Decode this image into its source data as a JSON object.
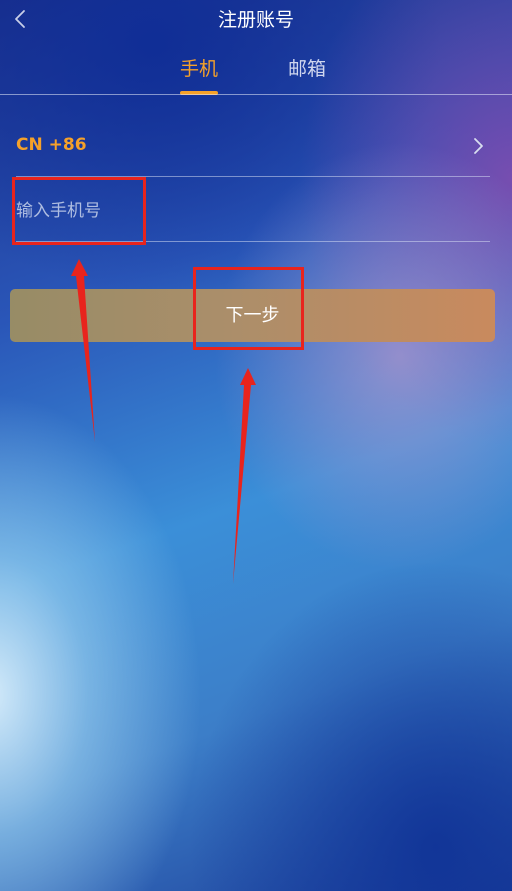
{
  "header": {
    "title": "注册账号",
    "back_icon": "chevron-left-icon"
  },
  "tabs": [
    {
      "label": "手机",
      "active": true
    },
    {
      "label": "邮箱",
      "active": false
    }
  ],
  "form": {
    "country_code": "CN +86",
    "country_icon": "chevron-right-icon",
    "phone_placeholder": "输入手机号",
    "phone_value": "",
    "next_label": "下一步"
  },
  "colors": {
    "accent": "#f5a12a",
    "annotation": "#e8241d",
    "button_start": "#978c66",
    "button_end": "#c98a5e"
  },
  "annotations": [
    "red-box-phone-input",
    "red-box-next-button",
    "red-arrow-phone-input",
    "red-arrow-next-button"
  ]
}
